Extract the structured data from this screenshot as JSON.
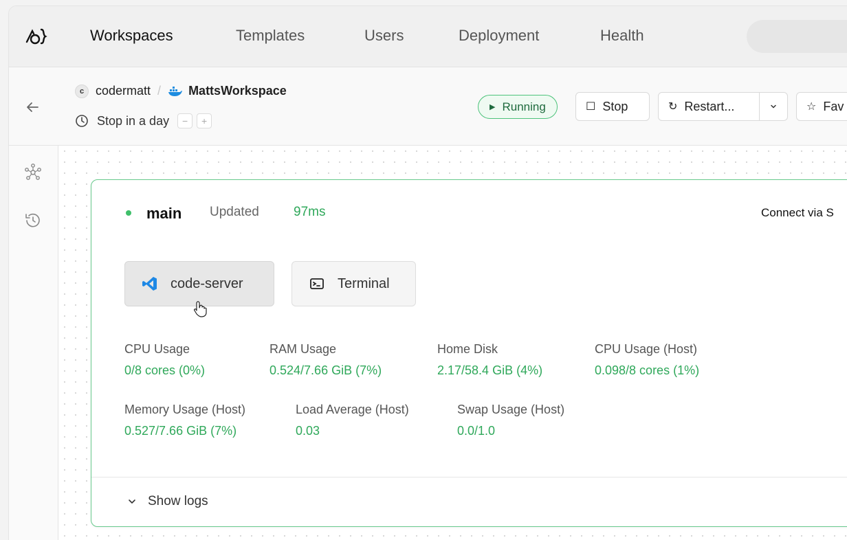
{
  "nav": {
    "items": [
      {
        "label": "Workspaces",
        "active": true
      },
      {
        "label": "Templates",
        "active": false
      },
      {
        "label": "Users",
        "active": false
      },
      {
        "label": "Deployment",
        "active": false
      },
      {
        "label": "Health",
        "active": false
      }
    ]
  },
  "workspace": {
    "owner_initial": "c",
    "owner": "codermatt",
    "separator": "/",
    "name": "MattsWorkspace",
    "schedule": "Stop in a day",
    "schedule_decrease": "−",
    "schedule_increase": "+"
  },
  "status": {
    "label": "Running",
    "color": "#4cc27a"
  },
  "actions": {
    "stop": "Stop",
    "restart": "Restart...",
    "favorite": "Fav"
  },
  "agent": {
    "name": "main",
    "updated_label": "Updated",
    "latency": "97ms",
    "connect_label": "Connect via S",
    "apps": [
      {
        "label": "code-server",
        "icon": "vscode-icon"
      },
      {
        "label": "Terminal",
        "icon": "terminal-icon"
      }
    ],
    "metrics": [
      {
        "label": "CPU Usage",
        "value": "0/8 cores (0%)"
      },
      {
        "label": "RAM Usage",
        "value": "0.524/7.66 GiB (7%)"
      },
      {
        "label": "Home Disk",
        "value": "2.17/58.4 GiB (4%)"
      },
      {
        "label": "CPU Usage (Host)",
        "value": "0.098/8 cores (1%)"
      },
      {
        "label": "Memory Usage (Host)",
        "value": "0.527/7.66 GiB (7%)"
      },
      {
        "label": "Load Average (Host)",
        "value": "0.03"
      },
      {
        "label": "Swap Usage (Host)",
        "value": "0.0/1.0"
      }
    ],
    "logs_toggle": "Show logs"
  },
  "colors": {
    "accent_green": "#2fa85a",
    "card_border": "#67c98c"
  }
}
